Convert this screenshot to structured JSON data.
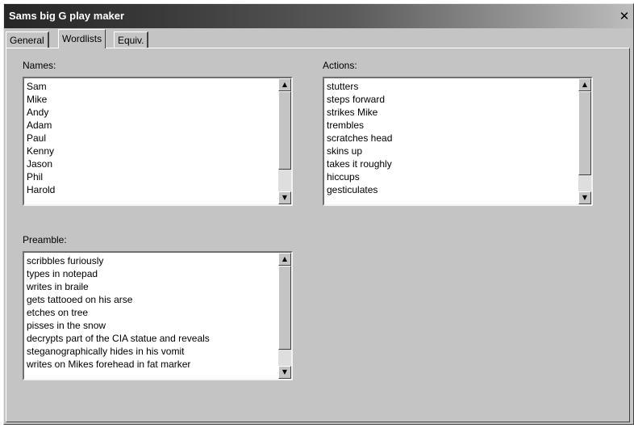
{
  "window": {
    "title": "Sams big G play maker",
    "close_glyph": "✕"
  },
  "tabs": [
    {
      "label": "General",
      "active": false
    },
    {
      "label": "Wordlists",
      "active": true
    },
    {
      "label": "Equiv.",
      "active": false
    }
  ],
  "names": {
    "label": "Names:",
    "items": [
      "Sam",
      "Mike",
      "Andy",
      "Adam",
      "Paul",
      "Kenny",
      "Jason",
      "Phil",
      "Harold"
    ],
    "scroll_position": 0,
    "visible_fraction": 0.78
  },
  "actions": {
    "label": "Actions:",
    "items": [
      "stutters",
      "steps forward",
      "strikes Mike",
      "trembles",
      "scratches head",
      "skins up",
      "takes it roughly",
      "hiccups",
      "gesticulates"
    ],
    "scroll_position": 0,
    "visible_fraction": 0.84
  },
  "preamble": {
    "label": "Preamble:",
    "items": [
      "scribbles furiously",
      "types in notepad",
      "writes in braile",
      "gets tattooed on his arse",
      "etches on tree",
      "pisses in the snow",
      "decrypts part of the CIA statue and reveals",
      "steganographically hides in his vomit",
      "writes on Mikes forehead in fat marker"
    ],
    "scroll_position": 0,
    "visible_fraction": 0.84
  },
  "icons": {
    "scroll_up": "▲",
    "scroll_down": "▼"
  },
  "colors": {
    "face": "#c4c4c4",
    "titlebar_dark": "#262626",
    "titlebar_light": "#bdbdbd"
  }
}
